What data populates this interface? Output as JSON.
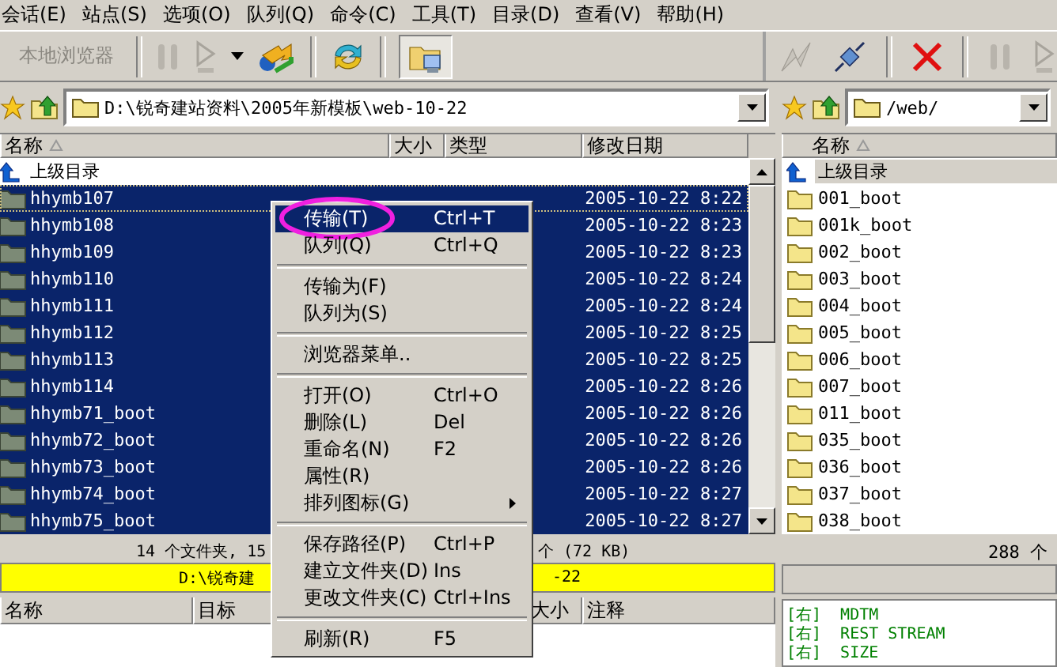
{
  "menu_bar": [
    "会话(E)",
    "站点(S)",
    "选项(O)",
    "队列(Q)",
    "命令(C)",
    "工具(T)",
    "目录(D)",
    "查看(V)",
    "帮助(H)"
  ],
  "left_toolbar": {
    "browser_label": "本地浏览器"
  },
  "left_path": "D:\\锐奇建站资料\\2005年新模板\\web-10-22",
  "left_columns": [
    "名称",
    "大小",
    "类型",
    "修改日期"
  ],
  "left_rows": [
    {
      "kind": "parent",
      "name": "上级目录",
      "selected": false
    },
    {
      "kind": "folder",
      "name": "hhymb107",
      "date": "2005-10-22 8:22",
      "selected": true
    },
    {
      "kind": "folder",
      "name": "hhymb108",
      "date": "2005-10-22 8:23",
      "selected": true
    },
    {
      "kind": "folder",
      "name": "hhymb109",
      "date": "2005-10-22 8:23",
      "selected": true
    },
    {
      "kind": "folder",
      "name": "hhymb110",
      "date": "2005-10-22 8:24",
      "selected": true
    },
    {
      "kind": "folder",
      "name": "hhymb111",
      "date": "2005-10-22 8:24",
      "selected": true
    },
    {
      "kind": "folder",
      "name": "hhymb112",
      "date": "2005-10-22 8:25",
      "selected": true
    },
    {
      "kind": "folder",
      "name": "hhymb113",
      "date": "2005-10-22 8:25",
      "selected": true
    },
    {
      "kind": "folder",
      "name": "hhymb114",
      "date": "2005-10-22 8:26",
      "selected": true
    },
    {
      "kind": "folder",
      "name": "hhymb71_boot",
      "date": "2005-10-22 8:26",
      "selected": true
    },
    {
      "kind": "folder",
      "name": "hhymb72_boot",
      "date": "2005-10-22 8:26",
      "selected": true
    },
    {
      "kind": "folder",
      "name": "hhymb73_boot",
      "date": "2005-10-22 8:26",
      "selected": true
    },
    {
      "kind": "folder",
      "name": "hhymb74_boot",
      "date": "2005-10-22 8:27",
      "selected": true
    },
    {
      "kind": "folder",
      "name": "hhymb75_boot",
      "date": "2005-10-22 8:27",
      "selected": true
    }
  ],
  "left_status": [
    "14 个文件夹, 15",
    "个 (72 KB)"
  ],
  "left_path_bar": [
    "D:\\锐奇建",
    "-22"
  ],
  "queue_columns": [
    "名称",
    "目标",
    "大小",
    "注释"
  ],
  "right_path": "/web/",
  "right_columns": [
    "名称"
  ],
  "right_rows": [
    {
      "kind": "parent",
      "name": "上级目录",
      "selected": true
    },
    {
      "kind": "folder",
      "name": "001_boot",
      "selected": false
    },
    {
      "kind": "folder",
      "name": "001k_boot",
      "selected": false
    },
    {
      "kind": "folder",
      "name": "002_boot",
      "selected": false
    },
    {
      "kind": "folder",
      "name": "003_boot",
      "selected": false
    },
    {
      "kind": "folder",
      "name": "004_boot",
      "selected": false
    },
    {
      "kind": "folder",
      "name": "005_boot",
      "selected": false
    },
    {
      "kind": "folder",
      "name": "006_boot",
      "selected": false
    },
    {
      "kind": "folder",
      "name": "007_boot",
      "selected": false
    },
    {
      "kind": "folder",
      "name": "011_boot",
      "selected": false
    },
    {
      "kind": "folder",
      "name": "035_boot",
      "selected": false
    },
    {
      "kind": "folder",
      "name": "036_boot",
      "selected": false
    },
    {
      "kind": "folder",
      "name": "037_boot",
      "selected": false
    },
    {
      "kind": "folder",
      "name": "038_boot",
      "selected": false
    }
  ],
  "right_status": "288 个",
  "log": [
    {
      "tag": "[右]",
      "text": "MDTM"
    },
    {
      "tag": "[右]",
      "text": "REST STREAM"
    },
    {
      "tag": "[右]",
      "text": "SIZE"
    }
  ],
  "context_menu": [
    [
      {
        "label": "传输(T)",
        "shortcut": "Ctrl+T",
        "selected": true,
        "circled": true
      },
      {
        "label": "队列(Q)",
        "shortcut": "Ctrl+Q",
        "selected": false
      }
    ],
    [
      {
        "label": "传输为(F)",
        "selected": false
      },
      {
        "label": "队列为(S)",
        "selected": false
      }
    ],
    [
      {
        "label": "浏览器菜单..",
        "selected": false
      }
    ],
    [
      {
        "label": "打开(O)",
        "shortcut": "Ctrl+O",
        "selected": false
      },
      {
        "label": "删除(L)",
        "shortcut": "Del",
        "selected": false
      },
      {
        "label": "重命名(N)",
        "shortcut": "F2",
        "selected": false
      },
      {
        "label": "属性(R)",
        "selected": false
      },
      {
        "label": "排列图标(G)",
        "submenu": true,
        "selected": false
      }
    ],
    [
      {
        "label": "保存路径(P)",
        "shortcut": "Ctrl+P",
        "selected": false
      },
      {
        "label": "建立文件夹(D)",
        "shortcut": "Ins",
        "selected": false
      },
      {
        "label": "更改文件夹(C)",
        "shortcut": "Ctrl+Ins",
        "selected": false
      }
    ],
    [
      {
        "label": "刷新(R)",
        "shortcut": "F5",
        "selected": false
      }
    ]
  ]
}
